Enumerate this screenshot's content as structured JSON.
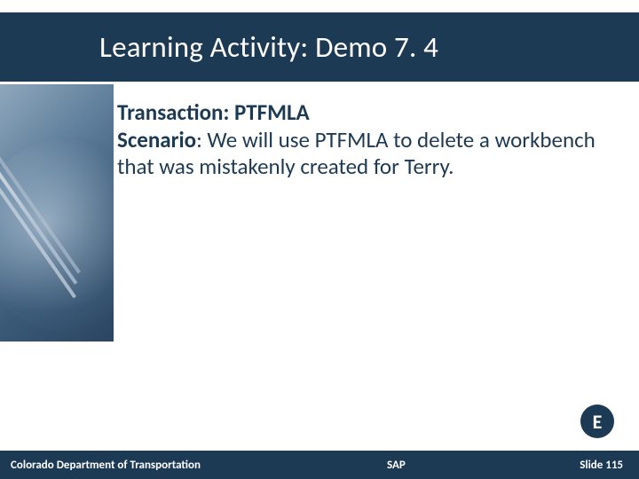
{
  "title": "Learning Activity:  Demo 7. 4",
  "body": {
    "transaction_label": "Transaction: ",
    "transaction_value": "PTFMLA",
    "scenario_label": "Scenario",
    "scenario_text": ": We will use PTFMLA to delete a workbench that was mistakenly created for Terry."
  },
  "badge": "E",
  "footer": {
    "org": "Colorado Department of Transportation",
    "mid": "SAP",
    "page": "Slide 115"
  }
}
